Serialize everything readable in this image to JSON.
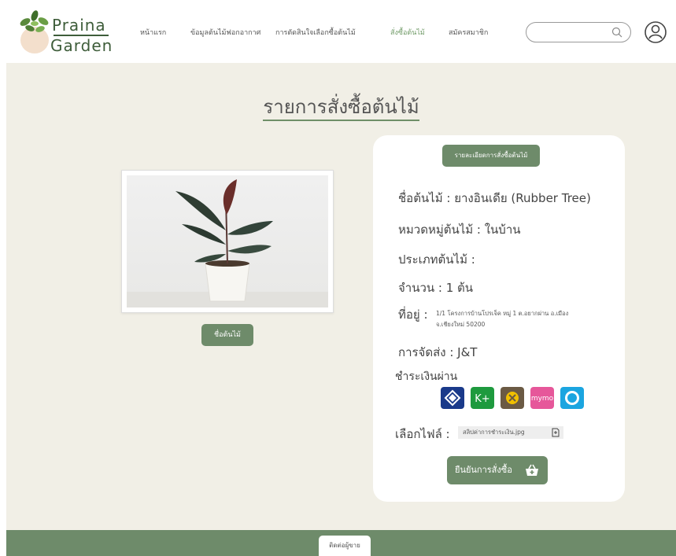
{
  "brand": {
    "name_line1": "Praina",
    "name_line2": "Garden"
  },
  "nav": [
    {
      "label": "หน้าแรก"
    },
    {
      "label": "ข้อมูลต้นไม้ฟอกอากาศ"
    },
    {
      "label": "การตัดสินใจเลือกซื้อต้นไม้"
    },
    {
      "label": "สั่งซื้อต้นไม้"
    },
    {
      "label": "สมัครสมาชิก"
    }
  ],
  "search": {
    "placeholder": ""
  },
  "page": {
    "title": "รายการสั่งซื้อต้นไม้"
  },
  "product": {
    "name_button": "ชื่อต้นไม้"
  },
  "order": {
    "header_button": "รายละเอียดการสั่งซื้อต้นไม้",
    "plant_name": "ชื่อต้นไม้ :  ยางอินเดีย (Rubber Tree)",
    "category": "หมวดหมู่ต้นไม้ :  ในบ้าน",
    "type": "ประเภทต้นไม้ :",
    "quantity": "จำนวน : 1 ต้น",
    "address_label": "ที่อยู่ :",
    "address_line1": "1/1 โครงการบ้านโปรเจ็ค หมู่ 1 ต.อยากผ่าน อ.เมือง",
    "address_line2": "จ.เชียงใหม่ 50200",
    "shipping": "การจัดส่ง :  J&T",
    "payment_label": "ชำระเงินผ่าน",
    "file_label": "เลือกไฟล์ :",
    "file_name": "สลิปค่าการชำระเงิน.jpg",
    "confirm_button": "ยืนยันการสั่งซื้อ"
  },
  "payment_icons": [
    "bangkok-bank-icon",
    "kplus-icon",
    "krungsri-icon",
    "mymo-icon",
    "krungthai-icon"
  ],
  "footer": {
    "contact_button": "ติดต่อผู้ขาย"
  },
  "colors": {
    "accent": "#6e8b6a",
    "background": "#f1efe6",
    "active_nav": "#6f9a66"
  }
}
